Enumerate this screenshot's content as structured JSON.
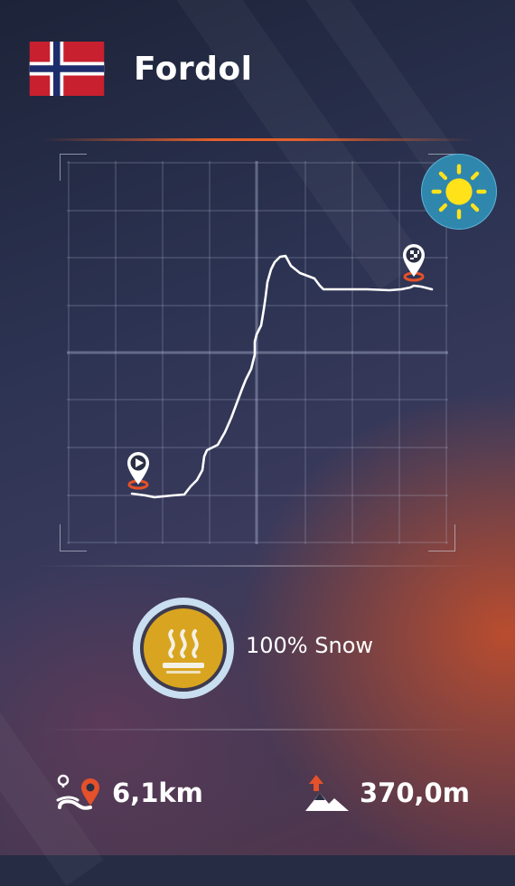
{
  "route": {
    "country_flag": "norway-flag",
    "name": "Fordol"
  },
  "weather": {
    "icon": "sun-icon",
    "condition": "sunny"
  },
  "map": {
    "start_marker": "play-pin-icon",
    "finish_marker": "checkered-flag-pin-icon",
    "line_color": "#ffffff",
    "marker_accent": "#e4512a"
  },
  "surface": {
    "icon": "heat-waves-icon",
    "label": "100% Snow",
    "badge_color": "#d9a520"
  },
  "stats": {
    "distance": {
      "icon": "route-distance-icon",
      "value": "6,1km"
    },
    "elevation": {
      "icon": "elevation-gain-icon",
      "value": "370,0m"
    }
  },
  "colors": {
    "accent": "#e4602c",
    "background": "#262c44"
  }
}
